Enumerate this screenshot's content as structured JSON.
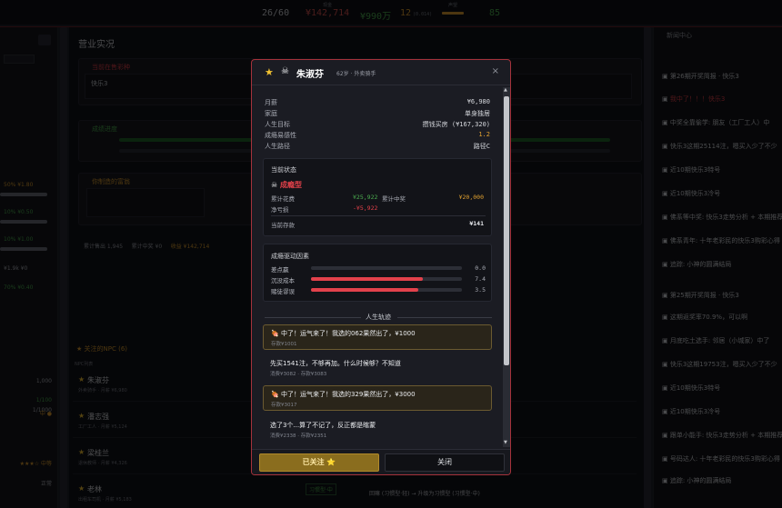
{
  "topbar": {
    "stats": [
      {
        "label": "",
        "value": "26/60",
        "sub": "",
        "color": "#d0d2d8"
      },
      {
        "label": "现金",
        "value": "¥142,714",
        "sub": "",
        "color": "#d9534f"
      },
      {
        "label": "",
        "value": "¥990万",
        "sub": "",
        "color": "#4caf50"
      },
      {
        "label": "",
        "value": "12",
        "sub": "(0.014)",
        "color": "#e0a030"
      },
      {
        "label": "声望",
        "value": "",
        "sub": "",
        "color": "#e0a030"
      },
      {
        "label": "",
        "value": "85",
        "sub": "",
        "color": "#4caf50"
      }
    ]
  },
  "left": {
    "rows": [
      "50% ¥1.80",
      "10% ¥0.50",
      "10% ¥1.00",
      "¥1.9k ¥0",
      "70% ¥0.40"
    ],
    "bottom_rows": [
      "1,000",
      "1/100",
      "1/1000",
      "中 ●",
      "★★★☆ 中等",
      "正常"
    ]
  },
  "main": {
    "title": "营业实况",
    "current_ticket": "当前在售彩种",
    "ticket_name": "快乐3",
    "progress_title": "成绩进度",
    "manufacture_title": "你制造的富翁",
    "stats_line": [
      "累计售出 1,945",
      "累计中奖 ¥0",
      "收益 ¥142,714"
    ],
    "npc_title": "关注的NPC (6)",
    "npc_list_label": "NPC列表",
    "npcs": [
      {
        "name": "朱淑芬",
        "sub": "外卖骑手 · 月薪 ¥6,980"
      },
      {
        "name": "潘志强",
        "sub": "工厂工人 · 月薪 ¥5,124"
      },
      {
        "name": "梁桂兰",
        "sub": "退休教师 · 月薪 ¥4,326"
      },
      {
        "name": "老林",
        "sub": "出租车司机 · 月薪 ¥5,183"
      }
    ],
    "npc_tag": "习惯型·中",
    "bottom_event": "回嘛 (习惯型·轻) → 升级为习惯型 (习惯型·中)"
  },
  "news": {
    "title": "新闻中心",
    "items": [
      "第26期开奖简报 · 快乐3",
      "我中了！！！快乐3",
      "中奖全靠偷学: 朋友（工厂工人）中",
      "快乐3这期25114注，嗯买入少了不少",
      "近10期快乐3特号",
      "近10期快乐3冷号",
      "佛系等中奖: 快乐3走势分析 + 本期推荐",
      "佛系青年: 十年老彩民的快乐3购彩心得",
      "追踪: 小神的圆满结局",
      "第25期开奖简报 · 快乐3",
      "这期返奖率70.9%，可以啊",
      "月底吃土选手: 邻居（小城家）中了",
      "快乐3这期19753注，嗯买入少了不少",
      "近10期快乐3特号",
      "近10期快乐3冷号",
      "跟单小能手: 快乐3走势分析 + 本期推荐",
      "号码达人: 十年老彩民的快乐3购彩心得",
      "追踪: 小神的圆满结局"
    ]
  },
  "modal": {
    "name": "朱淑芬",
    "meta": "62岁 · 外卖骑手",
    "close_symbol": "×",
    "info": [
      {
        "k": "月薪",
        "v": "¥6,980",
        "color": "#d6d8dd"
      },
      {
        "k": "家庭",
        "v": "单身独居",
        "color": "#d6d8dd"
      },
      {
        "k": "人生目标",
        "v": "攒钱买房 (¥167,320)",
        "color": "#d6d8dd"
      },
      {
        "k": "成瘾易感性",
        "v": "1.2",
        "color": "#e0a030"
      },
      {
        "k": "人生路径",
        "v": "路径C",
        "color": "#d6d8dd"
      }
    ],
    "state": {
      "title": "当前状态",
      "type": "成瘾型",
      "total_spend_label": "累计花费",
      "total_spend": "¥25,922",
      "total_win_label": "累计中奖",
      "total_win": "¥20,000",
      "net_loss_label": "净亏损",
      "net_loss": "-¥5,922",
      "savings_label": "当前存款",
      "savings": "¥141"
    },
    "factors": {
      "title": "成瘾驱动因素",
      "items": [
        {
          "label": "差点赢",
          "value": "0.0",
          "fill": 0.0
        },
        {
          "label": "沉没成本",
          "value": "7.4",
          "fill": 0.74
        },
        {
          "label": "赌徒谬误",
          "value": "3.5",
          "fill": 0.71
        }
      ]
    },
    "life_title": "人生轨迹",
    "events": [
      {
        "text": "🍖 中了！运气来了！我选的062果然出了，¥1000",
        "sub": "存款¥1001",
        "win": true
      },
      {
        "text": "先买1541注，不够再加。什么时候够？不知道",
        "sub": "消费¥3082 · 存款¥3083",
        "win": false
      },
      {
        "text": "🍖 中了！运气来了！我选的329果然出了，¥3000",
        "sub": "存款¥3017",
        "win": true
      },
      {
        "text": "选了3个...算了不记了，反正都是瞎蒙",
        "sub": "消费¥2338 · 存款¥2351",
        "win": false
      }
    ],
    "follow_label": "已关注 ⭐",
    "close_label": "关闭"
  }
}
